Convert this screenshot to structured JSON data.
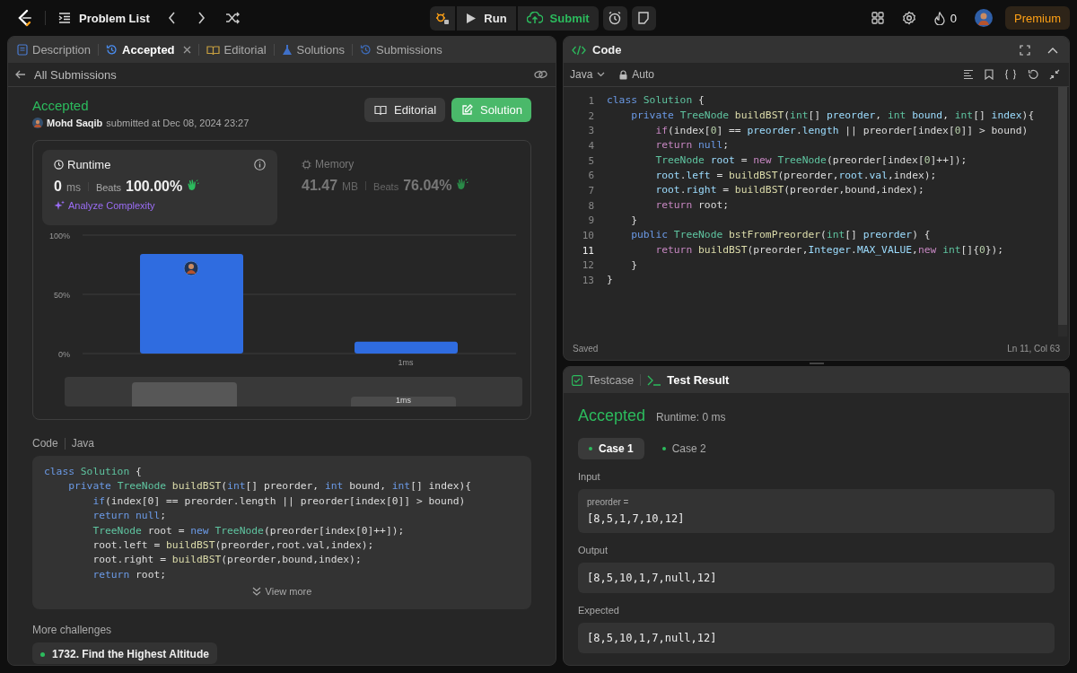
{
  "top_bar": {
    "problem_list": "Problem List",
    "run": "Run",
    "submit": "Submit",
    "streak": "0",
    "premium": "Premium"
  },
  "left_panel": {
    "tabs": [
      {
        "label": "Description",
        "selected": false,
        "closable": false
      },
      {
        "label": "Accepted",
        "selected": true,
        "closable": true
      },
      {
        "label": "Editorial",
        "selected": false,
        "closable": false
      },
      {
        "label": "Solutions",
        "selected": false,
        "closable": false
      },
      {
        "label": "Submissions",
        "selected": false,
        "closable": false
      }
    ],
    "back_link": "All Submissions",
    "submission": {
      "status": "Accepted",
      "user": "Mohd Saqib",
      "submitted": "submitted at Dec 08, 2024 23:27",
      "buttons": [
        "Editorial",
        "Solution"
      ]
    },
    "metrics": [
      {
        "kind": "runtime",
        "title": "Runtime",
        "value": "0",
        "unit": "ms",
        "beats_label": "Beats",
        "beats": "100.00%",
        "analyze": "Analyze Complexity",
        "selected": true
      },
      {
        "kind": "memory",
        "title": "Memory",
        "value": "41.47",
        "unit": "MB",
        "beats_label": "Beats",
        "beats": "76.04%",
        "selected": false
      }
    ],
    "chart_data": {
      "type": "bar",
      "categories": [
        null,
        "1ms"
      ],
      "values": [
        84,
        10
      ],
      "ylim": [
        0,
        100
      ],
      "yticks": [
        {
          "value": 0,
          "label": "0%"
        },
        {
          "value": 50,
          "label": "50%"
        },
        {
          "value": 100,
          "label": "100%"
        }
      ]
    },
    "navigator": {
      "label": "1ms"
    },
    "code_section": {
      "label": "Code",
      "language": "Java",
      "view_more": "View more",
      "lines": [
        [
          {
            "text": "class ",
            "kind": "k"
          },
          {
            "text": "Solution",
            "kind": "t"
          },
          {
            "text": " {",
            "kind": "p"
          }
        ],
        [
          {
            "text": "    private ",
            "kind": "k"
          },
          {
            "text": "TreeNode ",
            "kind": "t"
          },
          {
            "text": "buildBST",
            "kind": "f"
          },
          {
            "text": "(",
            "kind": "p"
          },
          {
            "text": "int",
            "kind": "k"
          },
          {
            "text": "[] preorder, ",
            "kind": "p"
          },
          {
            "text": "int ",
            "kind": "k"
          },
          {
            "text": "bound, ",
            "kind": "p"
          },
          {
            "text": "int",
            "kind": "k"
          },
          {
            "text": "[] index){",
            "kind": "p"
          }
        ],
        [
          {
            "text": "        if",
            "kind": "k"
          },
          {
            "text": "(index[0] == preorder.length || preorder[index[0]] > bound)",
            "kind": "p"
          }
        ],
        [
          {
            "text": "        return ",
            "kind": "k"
          },
          {
            "text": "null",
            "kind": "k"
          },
          {
            "text": ";",
            "kind": "p"
          }
        ],
        [
          {
            "text": "        TreeNode ",
            "kind": "t"
          },
          {
            "text": "root = ",
            "kind": "p"
          },
          {
            "text": "new ",
            "kind": "k"
          },
          {
            "text": "TreeNode",
            "kind": "t"
          },
          {
            "text": "(preorder[index[0]++]);",
            "kind": "p"
          }
        ],
        [
          {
            "text": "        root.left = ",
            "kind": "p"
          },
          {
            "text": "buildBST",
            "kind": "f"
          },
          {
            "text": "(preorder,root.val,index);",
            "kind": "p"
          }
        ],
        [
          {
            "text": "        root.right = ",
            "kind": "p"
          },
          {
            "text": "buildBST",
            "kind": "f"
          },
          {
            "text": "(preorder,bound,index);",
            "kind": "p"
          }
        ],
        [
          {
            "text": "        return ",
            "kind": "k"
          },
          {
            "text": "root;",
            "kind": "p"
          }
        ]
      ]
    },
    "more_challenges": {
      "title": "More challenges",
      "items": [
        "1732. Find the Highest Altitude"
      ]
    }
  },
  "editor": {
    "title": "Code",
    "language": "Java",
    "mode": "Auto",
    "status": "Saved",
    "cursor": "Ln 11, Col 63",
    "lines": [
      {
        "number": "1",
        "current": false,
        "tokens": [
          {
            "text": "class ",
            "kind": "k"
          },
          {
            "text": "Solution",
            "kind": "t"
          },
          {
            "text": " {",
            "kind": "p"
          }
        ]
      },
      {
        "number": "2",
        "current": false,
        "tokens": [
          {
            "text": "    private ",
            "kind": "k"
          },
          {
            "text": "TreeNode ",
            "kind": "t"
          },
          {
            "text": "buildBST",
            "kind": "f"
          },
          {
            "text": "(",
            "kind": "p"
          },
          {
            "text": "int",
            "kind": "t"
          },
          {
            "text": "[] ",
            "kind": "p"
          },
          {
            "text": "preorder",
            "kind": "v"
          },
          {
            "text": ", ",
            "kind": "p"
          },
          {
            "text": "int ",
            "kind": "t"
          },
          {
            "text": "bound",
            "kind": "v"
          },
          {
            "text": ", ",
            "kind": "p"
          },
          {
            "text": "int",
            "kind": "t"
          },
          {
            "text": "[] ",
            "kind": "p"
          },
          {
            "text": "index",
            "kind": "v"
          },
          {
            "text": "){",
            "kind": "p"
          }
        ]
      },
      {
        "number": "3",
        "current": false,
        "tokens": [
          {
            "text": "        if",
            "kind": "c"
          },
          {
            "text": "(index[",
            "kind": "p"
          },
          {
            "text": "0",
            "kind": "n"
          },
          {
            "text": "] == ",
            "kind": "p"
          },
          {
            "text": "preorder",
            "kind": "v"
          },
          {
            "text": ".",
            "kind": "p"
          },
          {
            "text": "length",
            "kind": "v"
          },
          {
            "text": " || preorder[index[",
            "kind": "p"
          },
          {
            "text": "0",
            "kind": "n"
          },
          {
            "text": "]] > bound)",
            "kind": "p"
          }
        ]
      },
      {
        "number": "4",
        "current": false,
        "tokens": [
          {
            "text": "        return ",
            "kind": "c"
          },
          {
            "text": "null",
            "kind": "k"
          },
          {
            "text": ";",
            "kind": "p"
          }
        ]
      },
      {
        "number": "5",
        "current": false,
        "tokens": [
          {
            "text": "        TreeNode ",
            "kind": "t"
          },
          {
            "text": "root",
            "kind": "v"
          },
          {
            "text": " = ",
            "kind": "p"
          },
          {
            "text": "new ",
            "kind": "c"
          },
          {
            "text": "TreeNode",
            "kind": "t"
          },
          {
            "text": "(preorder[index[",
            "kind": "p"
          },
          {
            "text": "0",
            "kind": "n"
          },
          {
            "text": "]++]);",
            "kind": "p"
          }
        ]
      },
      {
        "number": "6",
        "current": false,
        "tokens": [
          {
            "text": "        root",
            "kind": "v"
          },
          {
            "text": ".",
            "kind": "p"
          },
          {
            "text": "left",
            "kind": "v"
          },
          {
            "text": " = ",
            "kind": "p"
          },
          {
            "text": "buildBST",
            "kind": "f"
          },
          {
            "text": "(preorder,",
            "kind": "p"
          },
          {
            "text": "root",
            "kind": "v"
          },
          {
            "text": ".",
            "kind": "p"
          },
          {
            "text": "val",
            "kind": "v"
          },
          {
            "text": ",index);",
            "kind": "p"
          }
        ]
      },
      {
        "number": "7",
        "current": false,
        "tokens": [
          {
            "text": "        root",
            "kind": "v"
          },
          {
            "text": ".",
            "kind": "p"
          },
          {
            "text": "right",
            "kind": "v"
          },
          {
            "text": " = ",
            "kind": "p"
          },
          {
            "text": "buildBST",
            "kind": "f"
          },
          {
            "text": "(preorder,bound,index);",
            "kind": "p"
          }
        ]
      },
      {
        "number": "8",
        "current": false,
        "tokens": [
          {
            "text": "        return ",
            "kind": "c"
          },
          {
            "text": "root;",
            "kind": "p"
          }
        ]
      },
      {
        "number": "9",
        "current": false,
        "tokens": [
          {
            "text": "    }",
            "kind": "p"
          }
        ]
      },
      {
        "number": "10",
        "current": false,
        "tokens": [
          {
            "text": "    public ",
            "kind": "k"
          },
          {
            "text": "TreeNode ",
            "kind": "t"
          },
          {
            "text": "bstFromPreorder",
            "kind": "f"
          },
          {
            "text": "(",
            "kind": "p"
          },
          {
            "text": "int",
            "kind": "t"
          },
          {
            "text": "[] ",
            "kind": "p"
          },
          {
            "text": "preorder",
            "kind": "v"
          },
          {
            "text": ") {",
            "kind": "p"
          }
        ]
      },
      {
        "number": "11",
        "current": true,
        "tokens": [
          {
            "text": "        return ",
            "kind": "c"
          },
          {
            "text": "buildBST",
            "kind": "f"
          },
          {
            "text": "(preorder,",
            "kind": "p"
          },
          {
            "text": "Integer",
            "kind": "v"
          },
          {
            "text": ".",
            "kind": "p"
          },
          {
            "text": "MAX_VALUE",
            "kind": "v"
          },
          {
            "text": ",",
            "kind": "p"
          },
          {
            "text": "new ",
            "kind": "c"
          },
          {
            "text": "int",
            "kind": "t"
          },
          {
            "text": "[]{",
            "kind": "p"
          },
          {
            "text": "0",
            "kind": "n"
          },
          {
            "text": "});",
            "kind": "p"
          }
        ]
      },
      {
        "number": "12",
        "current": false,
        "tokens": [
          {
            "text": "    }",
            "kind": "p"
          }
        ]
      },
      {
        "number": "13",
        "current": false,
        "tokens": [
          {
            "text": "}",
            "kind": "p"
          }
        ]
      }
    ]
  },
  "results": {
    "tabs": [
      {
        "label": "Testcase",
        "selected": false
      },
      {
        "label": "Test Result",
        "selected": true
      }
    ],
    "status": "Accepted",
    "runtime": "Runtime: 0 ms",
    "cases": [
      {
        "label": "Case 1",
        "selected": true
      },
      {
        "label": "Case 2",
        "selected": false
      }
    ],
    "input_label": "Input",
    "params": [
      {
        "name": "preorder =",
        "value": "[8,5,1,7,10,12]"
      }
    ],
    "output_label": "Output",
    "output": "[8,5,10,1,7,null,12]",
    "expected_label": "Expected",
    "expected": "[8,5,10,1,7,null,12]"
  }
}
